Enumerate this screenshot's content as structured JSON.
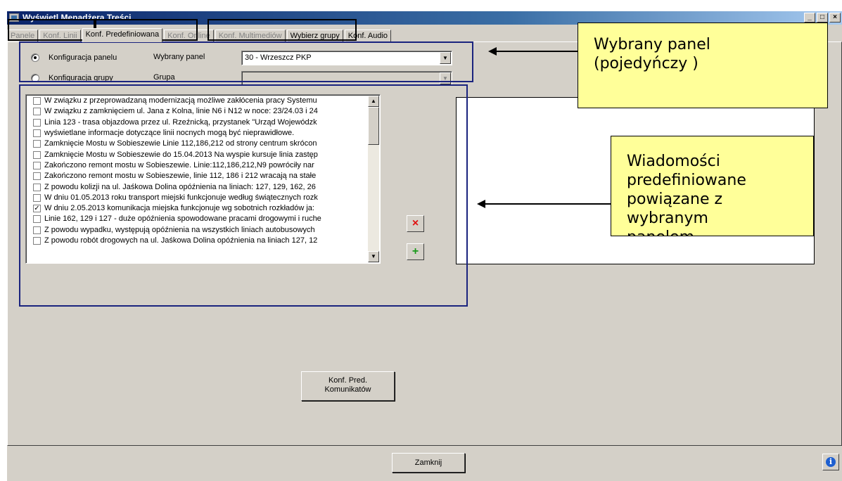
{
  "window": {
    "title": "Wyświetl Menadżera Treści",
    "buttons": {
      "minimize": "_",
      "maximize": "□",
      "close": "×"
    }
  },
  "tabs": [
    {
      "label": "Panele"
    },
    {
      "label": "Konf. Linii"
    },
    {
      "label": "Konf. Predefiniowana"
    },
    {
      "label": "Konf. Online"
    },
    {
      "label": "Konf. Multimediów"
    },
    {
      "label": "Wybierz grupy"
    },
    {
      "label": "Konf. Audio"
    }
  ],
  "selector": {
    "panel_radio_label": "Konfiguracja panelu",
    "panel_field_label": "Wybrany panel",
    "panel_value": "30 - Wrzeszcz PKP",
    "group_radio_label": "Konfiguracja grupy",
    "group_field_label": "Grupa",
    "group_value": ""
  },
  "messages": [
    {
      "checked": false,
      "text": "W związku z przeprowadzaną modernizacją możliwe zakłócenia pracy Systemu"
    },
    {
      "checked": false,
      "text": "W związku z zamknięciem ul. Jana z Kolna, linie N6 i N12 w noce: 23/24.03 i 24"
    },
    {
      "checked": false,
      "text": "Linia 123 - trasa objazdowa przez ul. Rzeźnicką, przystanek \"Urząd Wojewódzk"
    },
    {
      "checked": false,
      "text": "wyświetlane informacje dotyczące linii nocnych mogą być nieprawidłowe."
    },
    {
      "checked": false,
      "text": "Zamknięcie Mostu w Sobieszewie Linie 112,186,212 od strony centrum skrócon"
    },
    {
      "checked": false,
      "text": "Zamknięcie Mostu w Sobieszewie do 15.04.2013 Na wyspie kursuje linia zastęp"
    },
    {
      "checked": false,
      "text": "Zakończono remont mostu w Sobieszewie. Linie:112,186,212,N9 powróciły nar"
    },
    {
      "checked": false,
      "text": "Zakończono remont mostu w Sobieszewie, linie 112, 186 i 212 wracają na stałe"
    },
    {
      "checked": false,
      "text": "Z powodu kolizji na ul. Jaśkowa Dolina opóźnienia na liniach: 127, 129, 162, 26"
    },
    {
      "checked": false,
      "text": "W dniu 01.05.2013 roku transport miejski funkcjonuje według świątecznych rozk"
    },
    {
      "checked": true,
      "text": "W dniu 2.05.2013 komunikacja miejska funkcjonuje wg sobotnich rozkładów ja:"
    },
    {
      "checked": false,
      "text": "Linie 162, 129 i 127 - duże opóźnienia spowodowane pracami drogowymi i ruche"
    },
    {
      "checked": false,
      "text": "Z powodu wypadku, występują opóźnienia na wszystkich liniach autobusowych"
    },
    {
      "checked": false,
      "text": "Z powodu robót drogowych na ul. Jaśkowa Dolina opóźnienia na liniach 127, 12"
    }
  ],
  "actions": {
    "delete_icon": "×",
    "add_icon": "+",
    "config_button": "Konf. Pred. Komunikatów",
    "close_button": "Zamknij",
    "info_icon": "i"
  },
  "annotations": {
    "panel_callout": "Wybrany panel (pojedyńczy )",
    "messages_callout": "Wiadomości predefiniowane powiązane z wybranym panelem"
  }
}
